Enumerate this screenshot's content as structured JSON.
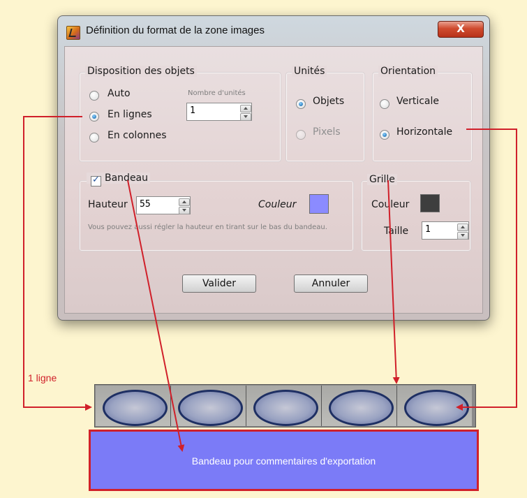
{
  "dialog": {
    "title": "Définition du format de la zone images",
    "close_label": "X"
  },
  "disposition": {
    "legend": "Disposition des objets",
    "options": [
      {
        "label": "Auto",
        "checked": false
      },
      {
        "label": "En lignes",
        "checked": true
      },
      {
        "label": "En colonnes",
        "checked": false
      }
    ],
    "units_count_label": "Nombre d'unités",
    "units_count_value": "1"
  },
  "unites": {
    "legend": "Unités",
    "options": [
      {
        "label": "Objets",
        "checked": true,
        "enabled": true
      },
      {
        "label": "Pixels",
        "checked": false,
        "enabled": false
      }
    ]
  },
  "orientation": {
    "legend": "Orientation",
    "options": [
      {
        "label": "Verticale",
        "checked": false
      },
      {
        "label": "Horizontale",
        "checked": true
      }
    ]
  },
  "bandeau": {
    "legend": "Bandeau",
    "checked": true,
    "height_label": "Hauteur",
    "height_value": "55",
    "color_label": "Couleur",
    "color": "#8b8bff",
    "hint": "Vous pouvez aussi régler la hauteur en tirant sur le bas du bandeau."
  },
  "grille": {
    "legend": "Grille",
    "color_label": "Couleur",
    "color": "#3e3e3e",
    "size_label": "Taille",
    "size_value": "1"
  },
  "buttons": {
    "validate": "Valider",
    "cancel": "Annuler"
  },
  "preview": {
    "rows_label": "1 ligne",
    "cell_count": 5,
    "banner_text": "Bandeau pour commentaires d'exportation",
    "banner_color": "#7b7bf7",
    "arrow_color": "#d0202a"
  }
}
